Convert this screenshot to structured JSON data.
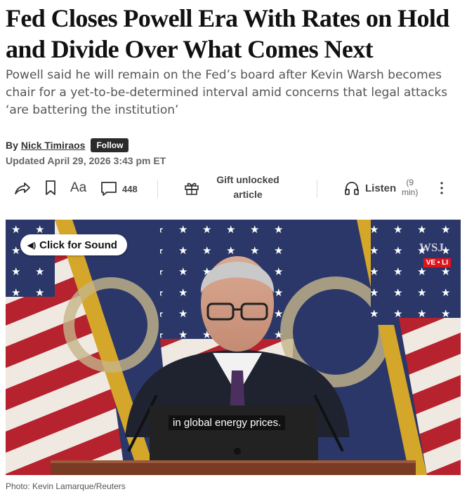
{
  "article": {
    "headline": "Fed Closes Powell Era With Rates on Hold and Divide Over What Comes Next",
    "dek": "Powell said he will remain on the Fed’s board after Kevin Warsh becomes chair for a yet-to-be-determined interval amid concerns that legal attacks ‘are battering the institution’",
    "byline_prefix": "By",
    "author": "Nick Timiraos",
    "follow_label": "Follow",
    "updated": "Updated April 29, 2026 3:43 pm ET"
  },
  "toolbar": {
    "text_size_label": "Aa",
    "comment_count": "448",
    "gift_label_line1": "Gift unlocked",
    "gift_label_line2": "article",
    "listen_label": "Listen",
    "listen_duration_line1": "(9",
    "listen_duration_line2": "min)"
  },
  "media": {
    "sound_button_label": "Click for Sound",
    "watermark": "WSJ",
    "live_tag": "VE • LI",
    "subtitle": "in global energy prices.",
    "credit": "Photo: Kevin Lamarque/Reuters"
  },
  "colors": {
    "flag_red": "#b6222e",
    "flag_blue": "#2a3768",
    "gold": "#d4a62a",
    "live_red": "#e0151c"
  }
}
